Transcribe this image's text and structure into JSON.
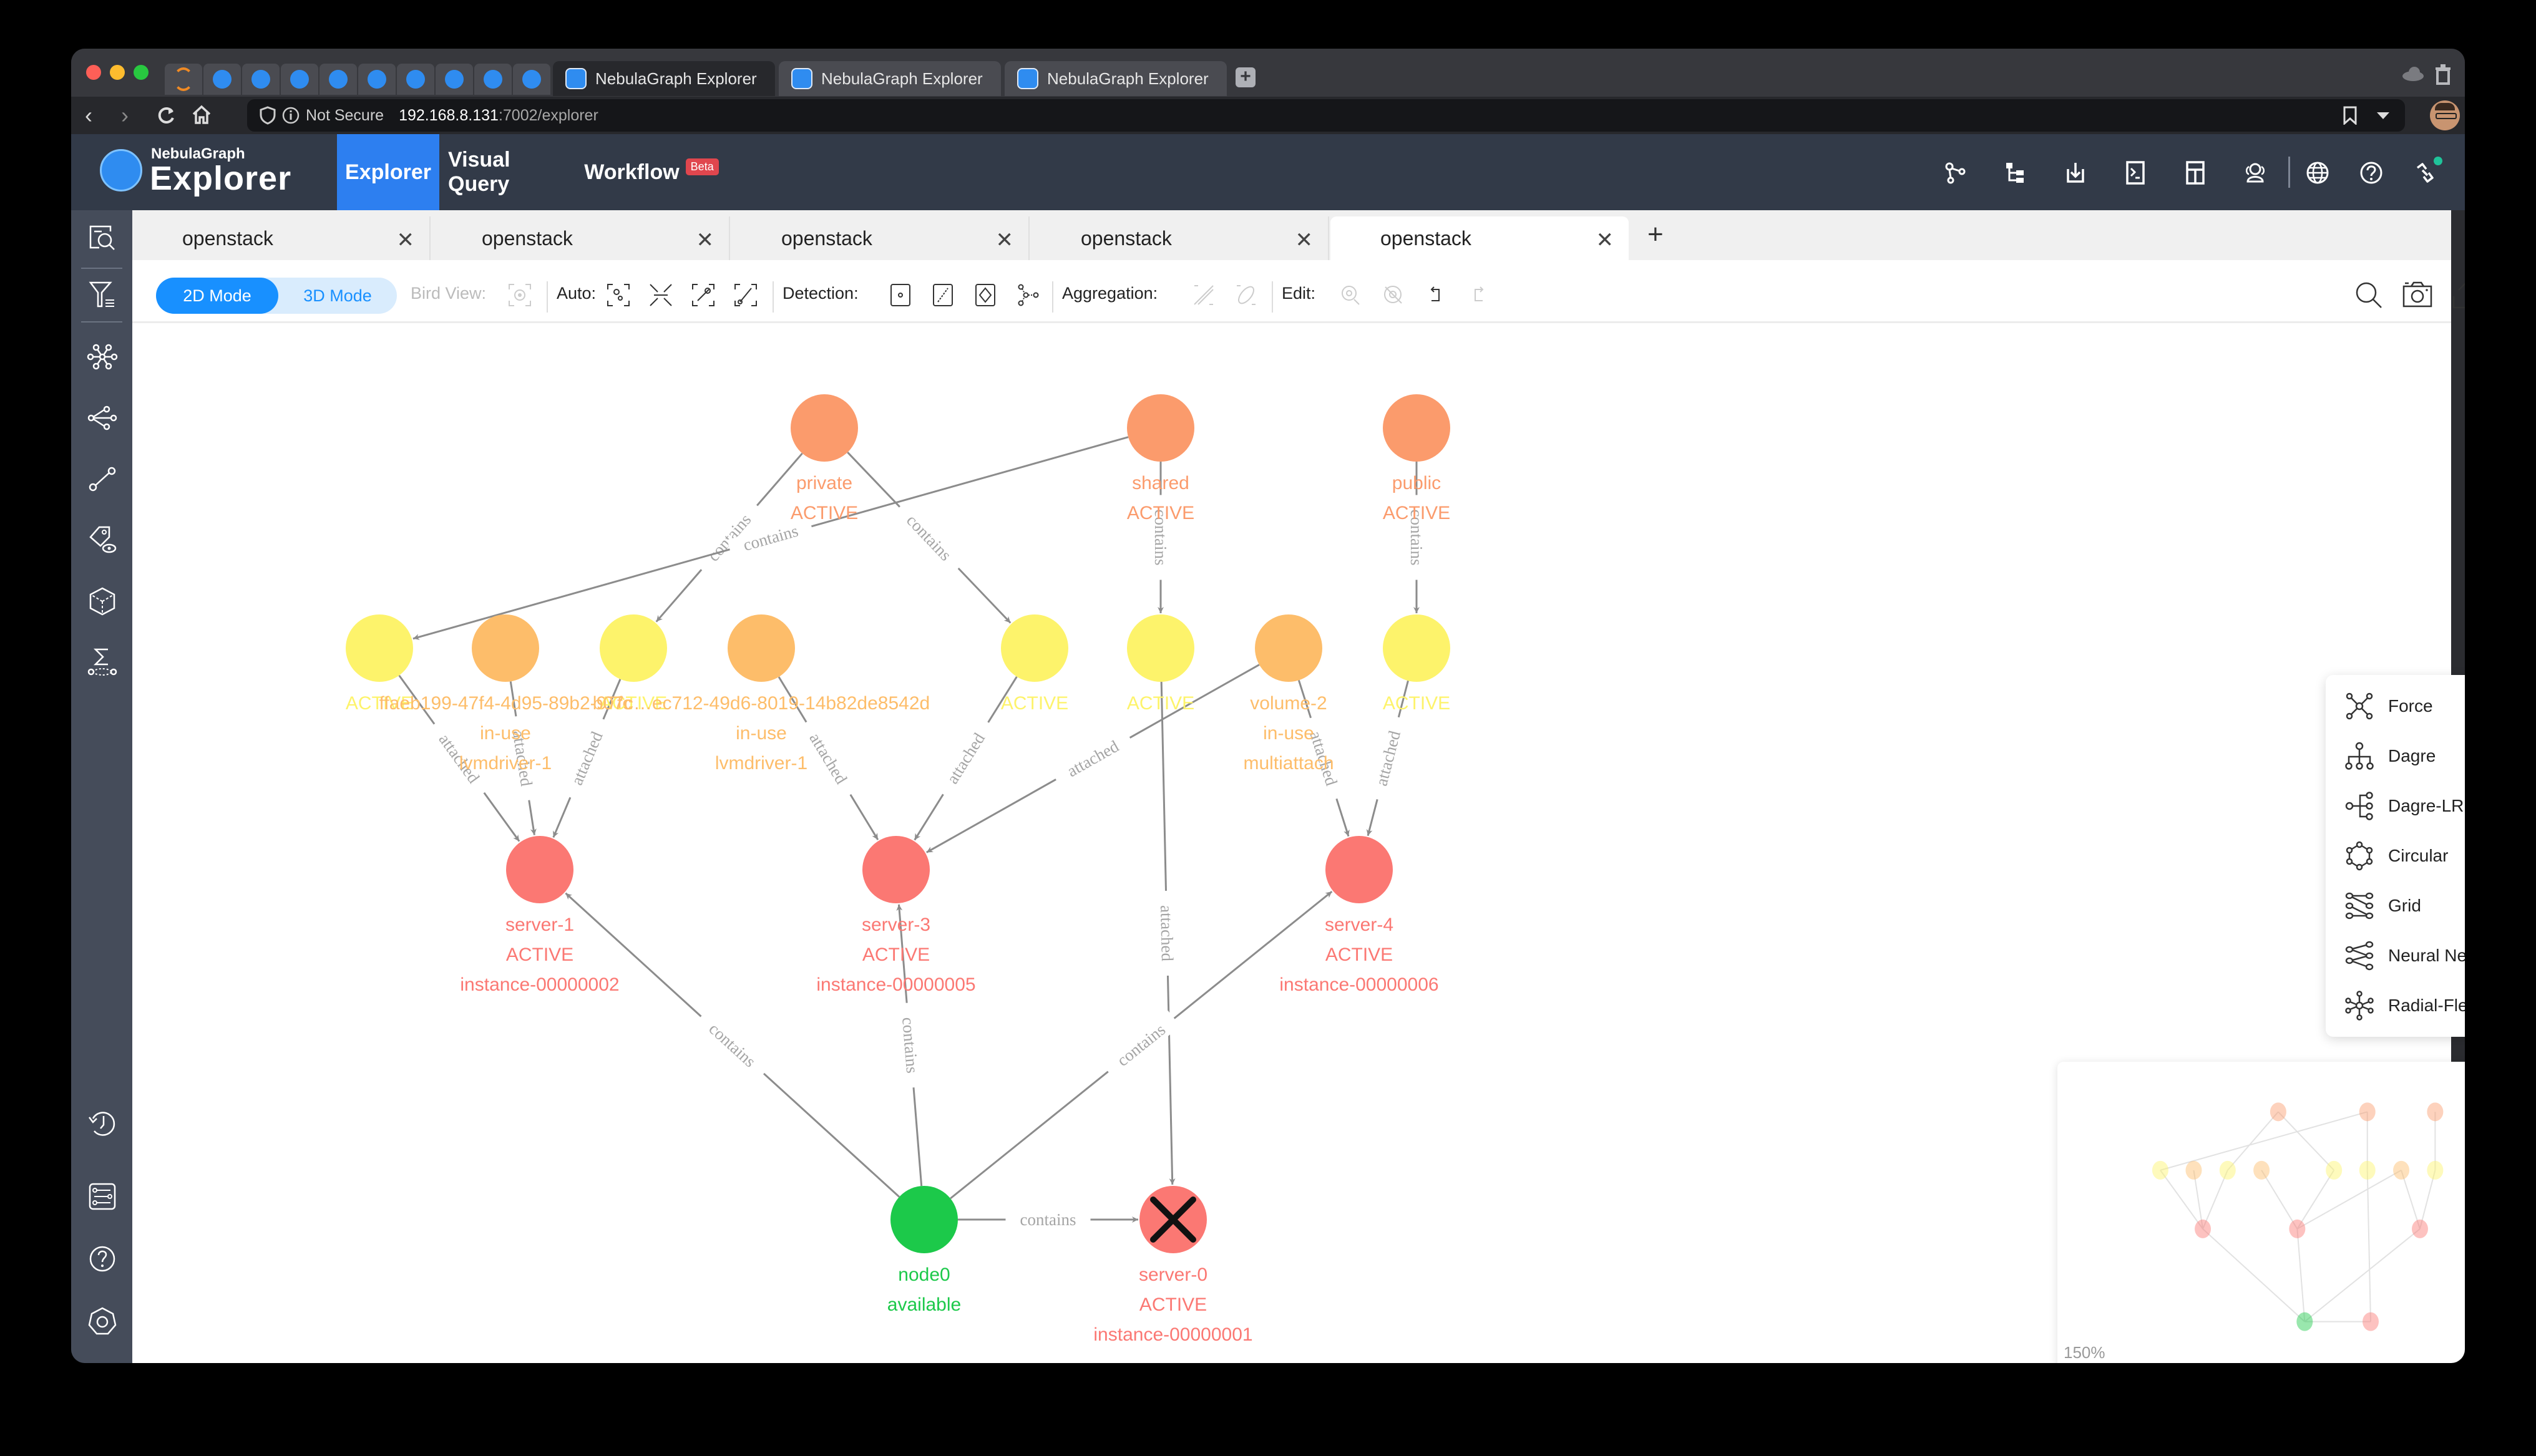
{
  "browser": {
    "pinned_tab_count": 10,
    "tabs": [
      {
        "title": "NebulaGraph Explorer",
        "active": true
      },
      {
        "title": "NebulaGraph Explorer",
        "active": false
      },
      {
        "title": "NebulaGraph Explorer",
        "active": false
      }
    ],
    "security_label": "Not Secure",
    "url_host": "192.168.8.131",
    "url_path": ":7002/explorer"
  },
  "app": {
    "logo_small": "NebulaGraph",
    "logo_big": "Explorer",
    "nav": [
      {
        "label": "Explorer",
        "active": true
      },
      {
        "label": "Visual Query",
        "active": false
      },
      {
        "label": "Workflow",
        "badge": "Beta",
        "active": false
      }
    ],
    "header_icons": [
      "schema-icon",
      "tree-icon",
      "import-icon",
      "console-icon",
      "layout-icon",
      "users-icon",
      "language-icon",
      "help-icon",
      "connection-icon"
    ],
    "connection_status_color": "#1fc39a"
  },
  "sidebar": {
    "top_icons": [
      "search-panel-icon",
      "filter-icon",
      "expand-icon",
      "common-neighbor-icon",
      "path-icon",
      "property-view-icon",
      "graph-algorithm-icon",
      "aggregation-icon"
    ],
    "bottom_icons": [
      "history-icon",
      "settings-list-icon",
      "help-icon",
      "preferences-icon"
    ]
  },
  "doc_tabs": [
    {
      "label": "openstack",
      "active": false
    },
    {
      "label": "openstack",
      "active": false
    },
    {
      "label": "openstack",
      "active": false
    },
    {
      "label": "openstack",
      "active": false
    },
    {
      "label": "openstack",
      "active": true
    }
  ],
  "toolbar": {
    "mode_2d": "2D Mode",
    "mode_3d": "3D Mode",
    "active_mode": "2D Mode",
    "bird_view": "Bird View:",
    "auto": "Auto:",
    "detection": "Detection:",
    "aggregation": "Aggregation:",
    "edit": "Edit:"
  },
  "graph": {
    "colors": {
      "network": "#fb9b6c",
      "subnet": "#fdf36b",
      "volume": "#fdbd6a",
      "server": "#fb7873",
      "host": "#1cc94a",
      "edge": "#8c8c8c",
      "edge_label": "#a5a5a5"
    },
    "nodes": [
      {
        "id": "private",
        "type": "network",
        "labels": [
          "private",
          "ACTIVE"
        ]
      },
      {
        "id": "shared",
        "type": "network",
        "labels": [
          "shared",
          "ACTIVE"
        ]
      },
      {
        "id": "public",
        "type": "network",
        "labels": [
          "public",
          "ACTIVE"
        ]
      },
      {
        "id": "subnet-a",
        "type": "subnet",
        "labels": [
          "ACTIVE"
        ]
      },
      {
        "id": "vol-a",
        "type": "volume",
        "labels": [
          "ffaeb199-47f4-4d95-89b2-97fc",
          "in-use",
          "lvmdriver-1"
        ]
      },
      {
        "id": "subnet-b",
        "type": "subnet",
        "labels": [
          "ACTIVE"
        ]
      },
      {
        "id": "vol-b",
        "type": "volume",
        "labels": [
          "b07c…ec712-49d6-8019-14b82de8542d",
          "in-use",
          "lvmdriver-1"
        ]
      },
      {
        "id": "subnet-c",
        "type": "subnet",
        "labels": [
          "ACTIVE"
        ]
      },
      {
        "id": "subnet-d",
        "type": "subnet",
        "labels": [
          "ACTIVE"
        ]
      },
      {
        "id": "volume-2",
        "type": "volume",
        "labels": [
          "volume-2",
          "in-use",
          "multiattach"
        ]
      },
      {
        "id": "subnet-e",
        "type": "subnet",
        "labels": [
          "ACTIVE"
        ]
      },
      {
        "id": "server-1",
        "type": "server",
        "labels": [
          "server-1",
          "ACTIVE",
          "instance-00000002"
        ]
      },
      {
        "id": "server-3",
        "type": "server",
        "labels": [
          "server-3",
          "ACTIVE",
          "instance-00000005"
        ]
      },
      {
        "id": "server-4",
        "type": "server",
        "labels": [
          "server-4",
          "ACTIVE",
          "instance-00000006"
        ]
      },
      {
        "id": "node0",
        "type": "host",
        "labels": [
          "node0",
          "available"
        ]
      },
      {
        "id": "server-0",
        "type": "server",
        "labels": [
          "server-0",
          "ACTIVE",
          "instance-00000001"
        ],
        "deleted": true
      }
    ],
    "edges": [
      {
        "from": "private",
        "to": "subnet-b",
        "label": "contains"
      },
      {
        "from": "private",
        "to": "subnet-c",
        "label": "contains"
      },
      {
        "from": "shared",
        "to": "subnet-a",
        "label": "contains"
      },
      {
        "from": "shared",
        "to": "subnet-d",
        "label": "contains"
      },
      {
        "from": "public",
        "to": "subnet-e",
        "label": "contains"
      },
      {
        "from": "subnet-a",
        "to": "server-1",
        "label": "attached"
      },
      {
        "from": "vol-a",
        "to": "server-1",
        "label": "attached"
      },
      {
        "from": "subnet-b",
        "to": "server-1",
        "label": "attached"
      },
      {
        "from": "vol-b",
        "to": "server-3",
        "label": "attached"
      },
      {
        "from": "subnet-c",
        "to": "server-3",
        "label": "attached"
      },
      {
        "from": "volume-2",
        "to": "server-3",
        "label": "attached"
      },
      {
        "from": "volume-2",
        "to": "server-4",
        "label": "attached"
      },
      {
        "from": "subnet-e",
        "to": "server-4",
        "label": "attached"
      },
      {
        "from": "subnet-d",
        "to": "server-0",
        "label": "attached"
      },
      {
        "from": "node0",
        "to": "server-1",
        "label": "contains"
      },
      {
        "from": "node0",
        "to": "server-3",
        "label": "contains"
      },
      {
        "from": "node0",
        "to": "server-4",
        "label": "contains"
      },
      {
        "from": "node0",
        "to": "server-0",
        "label": "contains"
      }
    ]
  },
  "layout_menu": {
    "items": [
      "Force",
      "Dagre",
      "Dagre-LR",
      "Circular",
      "Grid",
      "Neural Network",
      "Radial-Flex"
    ]
  },
  "minimap": {
    "zoom": "150%"
  }
}
